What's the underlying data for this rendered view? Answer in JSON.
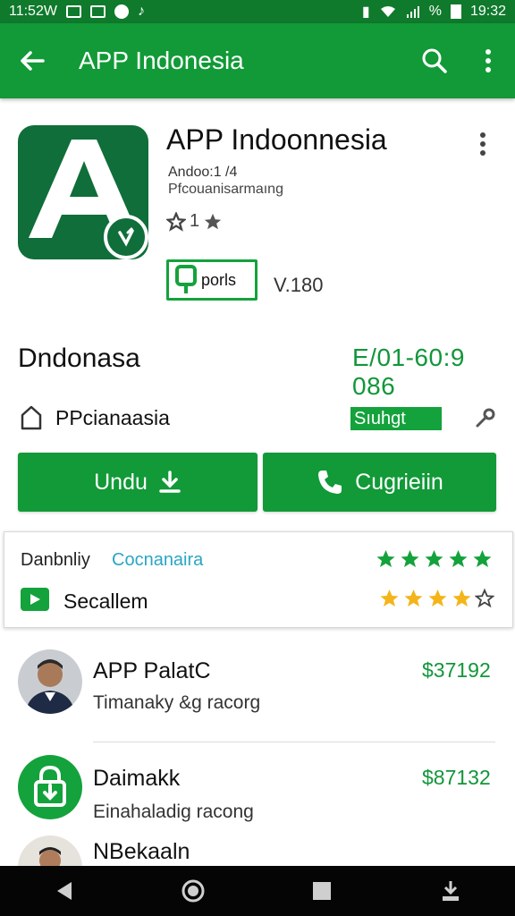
{
  "status_bar": {
    "time": "11:52W",
    "battery": "%",
    "clock_right": "19:32"
  },
  "app_bar": {
    "title": "APP Indonesia",
    "back_icon": "arrow-left-icon",
    "search_icon": "search-icon",
    "more_icon": "more-vert-icon"
  },
  "app": {
    "name": "APP Indoonnesia",
    "developer": "Andoo:1 /4",
    "category": "Pfcouanisarmaıng",
    "rating": "1",
    "badge": "porls",
    "version": "V.180"
  },
  "section": {
    "title": "Dndonasa",
    "value": "E/01-60:9 086"
  },
  "provider": {
    "name": "PPcianaasia",
    "status": "Sıuhgt"
  },
  "buttons": {
    "download": "Undu",
    "call": "Cugrieiin"
  },
  "card": {
    "label": "Danbnliy",
    "link": "Cocnanaira",
    "green_stars": 5,
    "row2_label": "Secallem",
    "gold_stars": 4
  },
  "list": [
    {
      "title": "APP PalatC",
      "subtitle": "Timanaky &g racorg",
      "price": "$37192"
    },
    {
      "title": "Daimakk",
      "subtitle": "Einahaladig racong",
      "price": "$87132"
    },
    {
      "title": "NBekaaln",
      "subtitle": "",
      "price": ""
    }
  ],
  "colors": {
    "primary": "#119a37",
    "status": "#0f7a2c",
    "accent_green_text": "#12963a",
    "star_gold": "#f3b51a",
    "link_blue": "#2aa6c4"
  }
}
